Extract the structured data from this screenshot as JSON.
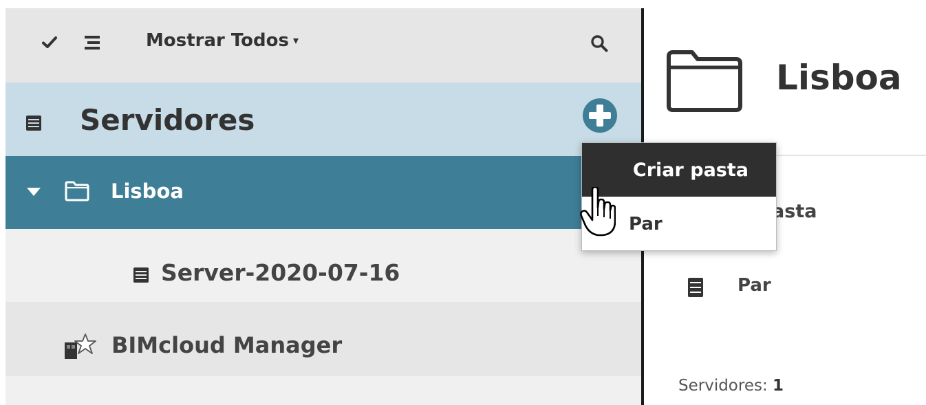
{
  "toolbar": {
    "check_icon": "check-icon",
    "list_icon": "list-icon",
    "filter_label": "Mostrar Todos",
    "filter_caret": "▾",
    "search_icon": "search-icon"
  },
  "servers_header": {
    "icon": "server-icon",
    "title": "Servidores",
    "add_icon": "plus-circle-icon"
  },
  "tree": {
    "lisboa": {
      "label": "Lisboa",
      "expanded": true,
      "selected": true
    },
    "server": {
      "label": "Server-2020-07-16"
    },
    "bimcloud": {
      "label": "BIMcloud Manager"
    }
  },
  "dropdown": {
    "items": [
      {
        "label": "Criar pasta",
        "highlighted": true
      },
      {
        "label": "Par",
        "highlighted": false
      }
    ]
  },
  "detail": {
    "title": "Lisboa",
    "create_action_visible": "r pasta",
    "par_label": "Par",
    "count_label": "Servidores:",
    "count_value": "1"
  },
  "colors": {
    "selected_row": "#3e7e96",
    "header_bg": "#c7dce6",
    "add_button": "#3e7e96",
    "menu_highlight": "#2f2f2f"
  }
}
